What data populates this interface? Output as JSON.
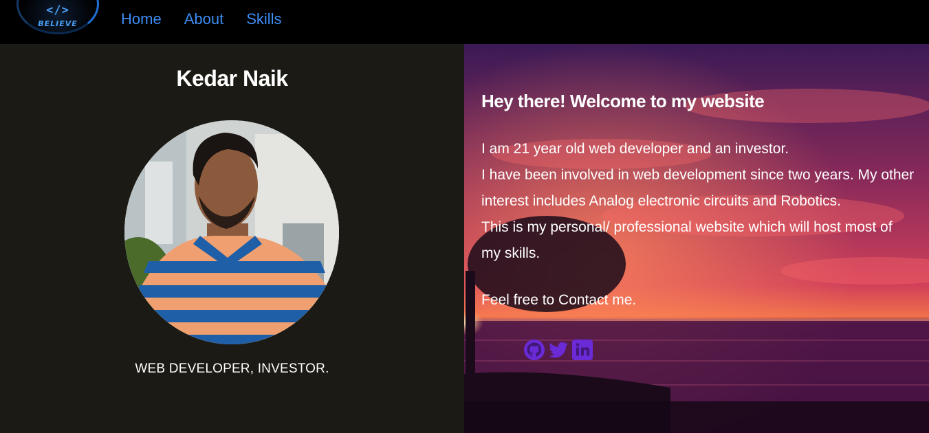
{
  "nav": {
    "logo": {
      "code": "</>",
      "text": "BELIEVE",
      "color": "#4a9ff5"
    },
    "links": [
      {
        "label": "Home"
      },
      {
        "label": "About"
      },
      {
        "label": "Skills"
      }
    ],
    "link_color": "#3d8ef5"
  },
  "profile": {
    "name": "Kedar Naik",
    "role": "WEB DEVELOPER, INVESTOR.",
    "panel_color": "#1b1a14"
  },
  "intro": {
    "title": "Hey there! Welcome to my website",
    "bio_lines": [
      "I am 21 year old web developer and an investor.",
      "I have been involved in web development since two years. My other interest includes Analog electronic circuits and Robotics.",
      "This is my personal/ professional website which will host most of my skills."
    ],
    "contact": "Feel free to Contact me."
  },
  "social": {
    "icons": [
      "github-icon",
      "twitter-icon",
      "linkedin-icon"
    ],
    "color": "#6a2bd6"
  }
}
